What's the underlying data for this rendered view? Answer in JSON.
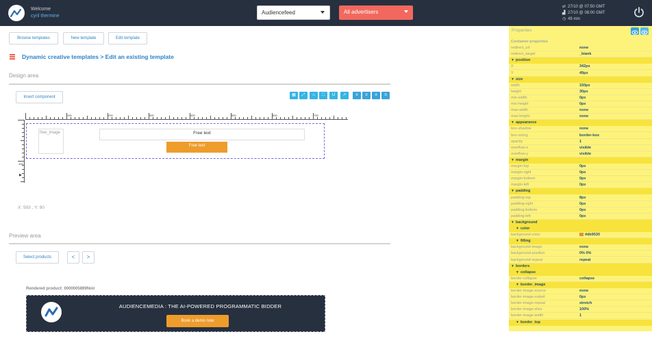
{
  "topbar": {
    "welcome": "Welcome",
    "username": "cyril thermine",
    "select_main": "Audiencefeed",
    "select_advertisers": "All advertisers",
    "time_1": "27/10 @ 07:50 GMT",
    "time_2": "27/10 @ 08:00 GMT",
    "time_3": "49 min"
  },
  "toolbar": {
    "browse": "Browse templates",
    "new": "New template",
    "edit": "Edit template"
  },
  "heading": "Dynamic creative templates > Edit an existing template",
  "design": {
    "title": "Design area",
    "insert_component": "Insert component",
    "ruler_labels": [
      "100",
      "200",
      "300",
      "400",
      "500",
      "600",
      "700"
    ],
    "vruler_label": "100",
    "free_image": "free_image",
    "free_text": "Free text",
    "free_button": "Free text",
    "coords": "X: 593 , Y: 90"
  },
  "preview": {
    "title": "Preview area",
    "select_products": "Select products",
    "prev": "<",
    "next": ">",
    "rendered_label": "Rendered product: 0000005899Noir",
    "banner_title": "AUDIENCEMEDIA : THE AI-POWERED PROGRAMMATIC BIDDER",
    "banner_button": "Book a demo now"
  },
  "properties": {
    "title": "Properties",
    "rows": [
      {
        "k": "Container properties",
        "v": "",
        "t": "hdr"
      },
      {
        "k": "redirect_url",
        "v": "none",
        "t": ""
      },
      {
        "k": "redirect_target",
        "v": "_blank",
        "t": ""
      },
      {
        "k": "position",
        "v": "",
        "t": "grp"
      },
      {
        "k": "X",
        "v": "342px",
        "t": ""
      },
      {
        "k": "Y",
        "v": "49px",
        "t": ""
      },
      {
        "k": "size",
        "v": "",
        "t": "grp"
      },
      {
        "k": "width",
        "v": "150px",
        "t": ""
      },
      {
        "k": "height",
        "v": "30px",
        "t": ""
      },
      {
        "k": "min-width",
        "v": "0px",
        "t": ""
      },
      {
        "k": "min-height",
        "v": "0px",
        "t": ""
      },
      {
        "k": "max-width",
        "v": "none",
        "t": ""
      },
      {
        "k": "max-height",
        "v": "none",
        "t": ""
      },
      {
        "k": "appearance",
        "v": "",
        "t": "grp"
      },
      {
        "k": "box-shadow",
        "v": "none",
        "t": ""
      },
      {
        "k": "box-sizing",
        "v": "border-box",
        "t": ""
      },
      {
        "k": "opacity",
        "v": "1",
        "t": ""
      },
      {
        "k": "overflow-x",
        "v": "visible",
        "t": ""
      },
      {
        "k": "overflow-y",
        "v": "visible",
        "t": ""
      },
      {
        "k": "margin",
        "v": "",
        "t": "grp"
      },
      {
        "k": "margin-top",
        "v": "0px",
        "t": ""
      },
      {
        "k": "margin-right",
        "v": "0px",
        "t": ""
      },
      {
        "k": "margin-bottom",
        "v": "0px",
        "t": ""
      },
      {
        "k": "margin-left",
        "v": "0px",
        "t": ""
      },
      {
        "k": "padding",
        "v": "",
        "t": "grp"
      },
      {
        "k": "padding-top",
        "v": "8px",
        "t": ""
      },
      {
        "k": "padding-right",
        "v": "0px",
        "t": ""
      },
      {
        "k": "padding-bottom",
        "v": "0px",
        "t": ""
      },
      {
        "k": "padding-left",
        "v": "0px",
        "t": ""
      },
      {
        "k": "background",
        "v": "",
        "t": "grp"
      },
      {
        "k": "color",
        "v": "",
        "t": "grp2"
      },
      {
        "k": "background-color",
        "v": "#db9530",
        "t": "color"
      },
      {
        "k": "filling",
        "v": "",
        "t": "grp2"
      },
      {
        "k": "background-image",
        "v": "none",
        "t": ""
      },
      {
        "k": "background-position",
        "v": "0% 0%",
        "t": ""
      },
      {
        "k": "background-repeat",
        "v": "repeat",
        "t": ""
      },
      {
        "k": "borders",
        "v": "",
        "t": "grp"
      },
      {
        "k": "collapse",
        "v": "",
        "t": "grp2"
      },
      {
        "k": "border-collapse",
        "v": "collapse",
        "t": ""
      },
      {
        "k": "border_image",
        "v": "",
        "t": "grp2"
      },
      {
        "k": "border-image-source",
        "v": "none",
        "t": ""
      },
      {
        "k": "border-image-outset",
        "v": "0px",
        "t": ""
      },
      {
        "k": "border-image-repeat",
        "v": "stretch",
        "t": ""
      },
      {
        "k": "border-image-slice",
        "v": "100%",
        "t": ""
      },
      {
        "k": "border-image-width",
        "v": "1",
        "t": ""
      },
      {
        "k": "border_top",
        "v": "",
        "t": "grp2"
      }
    ]
  },
  "colors": {
    "topbar": "#27303f",
    "accent_blue": "#2b83c6",
    "orange": "#ee9c2c",
    "red_select": "#f2685e",
    "properties_bg": "#fdf37a"
  },
  "icons": [
    "logo-icon",
    "power-icon",
    "hamburger-icon",
    "chevron-down-icon",
    "eye-icon",
    "clock-icon",
    "chart-icon",
    "arrows-icon"
  ]
}
